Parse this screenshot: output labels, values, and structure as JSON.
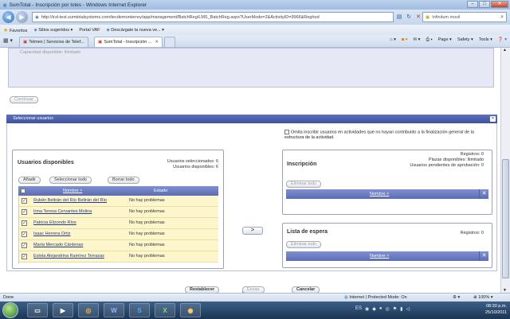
{
  "window": {
    "title": "SumTotal - Inscripción por lotes - Windows Internet Explorer",
    "address": "http://tcd-test.sumtotalsystems.com/tecdemonterrey/app/management/BatchReg/LMS_BatchReg.aspx?UserMode=2&ActivityID=9966&Reghod",
    "search_placeholder": "Infinitum movil"
  },
  "favorites": {
    "label": "Favoritos",
    "items": [
      "Sitios sugeridos ▾",
      "Portal VAF",
      "Descárgate la nueva ve... ▾"
    ]
  },
  "tabs": [
    {
      "label": "Telmex | Servicios de Telef..."
    },
    {
      "label": "SumTotal - Inscripción ..."
    }
  ],
  "commands": [
    "Page ▾",
    "Safety ▾",
    "Tools ▾"
  ],
  "top_section": {
    "capacity_label": "Capacidad disponible:",
    "capacity_value": "Ilimitado",
    "continue_button": "Continuar"
  },
  "select_users": {
    "header": "Seleccionar usuarios",
    "omit_text": "Omita inscribir usuarios en actividades que no hayan contribuido a la finalización general de la estructura de la actividad.",
    "available": {
      "title": "Usuarios disponibles",
      "selected_count_text": "Usuarios seleccionados: 6",
      "available_count_text": "Usuarios disponibles: 6",
      "buttons": {
        "add": "Añadir",
        "select_all": "Seleccionar todo",
        "clear_all": "Borrar todo"
      },
      "columns": {
        "name": "Nombre",
        "status": "Estado"
      },
      "rows": [
        {
          "name": "Rubén Beltrán del Río Beltrán del Río",
          "status": "No hay problemas"
        },
        {
          "name": "Irma Teresa Cervantes Molina",
          "status": "No hay problemas"
        },
        {
          "name": "Patricia Elizondo Ríos",
          "status": "No hay problemas"
        },
        {
          "name": "Isaac Herrera Ortiz",
          "status": "No hay problemas"
        },
        {
          "name": "María Mercado Cárdenas",
          "status": "No hay problemas"
        },
        {
          "name": "Estela Alejandrina Ramírez Terrazas",
          "status": "No hay problemas"
        }
      ]
    },
    "move_button": ">",
    "inscription": {
      "title": "Inscripción",
      "registros": "Registros: 0",
      "plazas": "Plazas disponibles: Ilimitado",
      "pendientes": "Usuarios pendientes de aprobación: 0",
      "remove_all": "Eliminar todo",
      "column_name": "Nombre"
    },
    "waitlist": {
      "title": "Lista de espera",
      "registros": "Registros: 0",
      "remove_all": "Eliminar todo",
      "column_name": "Nombre"
    }
  },
  "footer_buttons": {
    "reset": "Restablecer",
    "send": "Enviar",
    "cancel": "Cancelar"
  },
  "statusbar": {
    "left": "Done",
    "zone": "Internet | Protected Mode: On",
    "zoom": "100%"
  },
  "taskbar": {
    "lang": "ES",
    "time": "08:30 p.m.",
    "date": "25/10/2011"
  }
}
